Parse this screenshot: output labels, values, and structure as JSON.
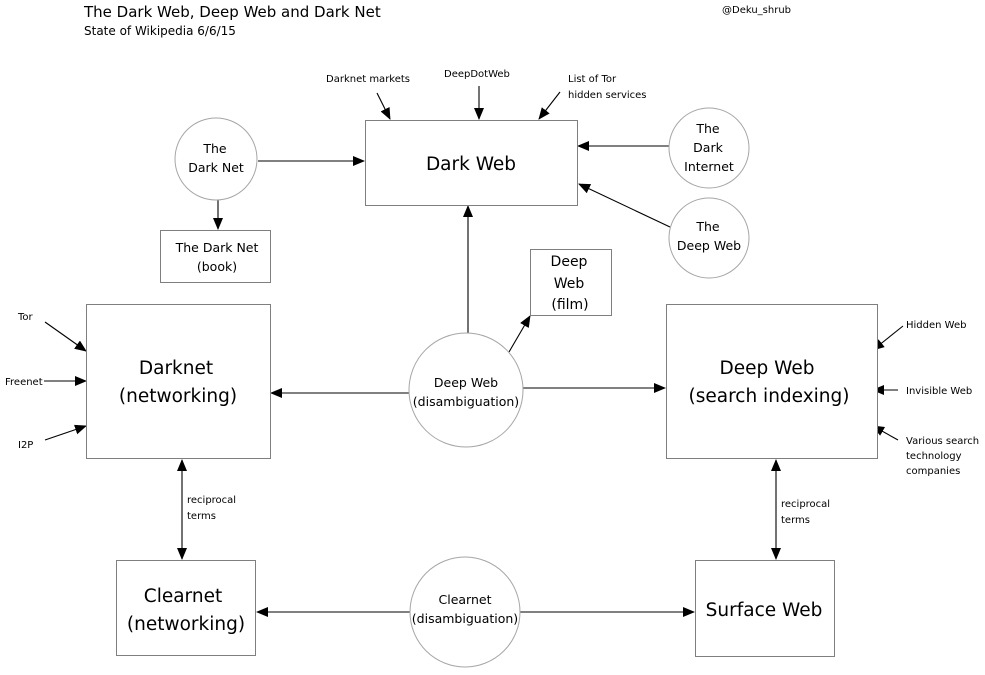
{
  "header": {
    "title": "The Dark Web, Deep Web and Dark Net",
    "subtitle": "State of Wikipedia 6/6/15",
    "author": "@Deku_shrub"
  },
  "nodes": {
    "dark_web": {
      "lines": [
        "Dark Web"
      ],
      "shape": "box"
    },
    "the_dark_net": {
      "lines": [
        "The",
        "Dark Net"
      ],
      "shape": "circle"
    },
    "the_dark_net_book": {
      "lines": [
        "The Dark Net",
        "(book)"
      ],
      "shape": "box"
    },
    "the_dark_internet": {
      "lines": [
        "The",
        "Dark",
        "Internet"
      ],
      "shape": "circle"
    },
    "the_deep_web": {
      "lines": [
        "The",
        "Deep Web"
      ],
      "shape": "circle"
    },
    "deep_web_film": {
      "lines": [
        "Deep",
        "Web",
        "(film)"
      ],
      "shape": "box"
    },
    "darknet_networking": {
      "lines": [
        "Darknet",
        "(networking)"
      ],
      "shape": "box"
    },
    "deep_web_disambiguation": {
      "lines": [
        "Deep Web",
        "(disambiguation)"
      ],
      "shape": "circle"
    },
    "deep_web_search_indexing": {
      "lines": [
        "Deep Web",
        "(search indexing)"
      ],
      "shape": "box"
    },
    "clearnet_networking": {
      "lines": [
        "Clearnet",
        "(networking)"
      ],
      "shape": "box"
    },
    "clearnet_disambiguation": {
      "lines": [
        "Clearnet",
        "(disambiguation)"
      ],
      "shape": "circle"
    },
    "surface_web": {
      "lines": [
        "Surface Web"
      ],
      "shape": "box"
    }
  },
  "labels": {
    "darknet_markets": [
      "Darknet markets"
    ],
    "deepdotweb": [
      "DeepDotWeb"
    ],
    "list_of_tor": [
      "List of Tor",
      "hidden services"
    ],
    "tor": [
      "Tor"
    ],
    "freenet": [
      "Freenet"
    ],
    "i2p": [
      "I2P"
    ],
    "hidden_web": [
      "Hidden Web"
    ],
    "invisible_web": [
      "Invisible Web"
    ],
    "various_search": [
      "Various search",
      "technology",
      "companies"
    ],
    "reciprocal_left": [
      "reciprocal",
      "terms"
    ],
    "reciprocal_right": [
      "reciprocal",
      "terms"
    ]
  },
  "edges": [
    {
      "from": "darknet_markets",
      "to": "dark_web"
    },
    {
      "from": "deepdotweb",
      "to": "dark_web"
    },
    {
      "from": "list_of_tor",
      "to": "dark_web"
    },
    {
      "from": "the_dark_net",
      "to": "dark_web"
    },
    {
      "from": "the_dark_net",
      "to": "the_dark_net_book"
    },
    {
      "from": "the_dark_internet",
      "to": "dark_web"
    },
    {
      "from": "the_deep_web",
      "to": "dark_web"
    },
    {
      "from": "deep_web_disambiguation",
      "to": "dark_web"
    },
    {
      "from": "deep_web_disambiguation",
      "to": "deep_web_film"
    },
    {
      "from": "deep_web_disambiguation",
      "to": "darknet_networking"
    },
    {
      "from": "deep_web_disambiguation",
      "to": "deep_web_search_indexing"
    },
    {
      "from": "tor",
      "to": "darknet_networking"
    },
    {
      "from": "freenet",
      "to": "darknet_networking"
    },
    {
      "from": "i2p",
      "to": "darknet_networking"
    },
    {
      "from": "hidden_web",
      "to": "deep_web_search_indexing"
    },
    {
      "from": "invisible_web",
      "to": "deep_web_search_indexing"
    },
    {
      "from": "various_search",
      "to": "deep_web_search_indexing"
    },
    {
      "from": "darknet_networking",
      "to": "clearnet_networking",
      "bidirectional": true,
      "label": "reciprocal terms"
    },
    {
      "from": "deep_web_search_indexing",
      "to": "surface_web",
      "bidirectional": true,
      "label": "reciprocal terms"
    },
    {
      "from": "clearnet_disambiguation",
      "to": "clearnet_networking"
    },
    {
      "from": "clearnet_disambiguation",
      "to": "surface_web"
    }
  ]
}
